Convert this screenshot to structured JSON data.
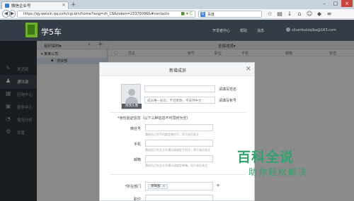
{
  "browser": {
    "tab_title": "微信企业号",
    "new_tab": "+",
    "url": "https://qy.weixin.qq.com/cgi-bin/home?lang=zh_CN&token=23370096&#contacts",
    "search_placeholder": "百度",
    "search_engine_badge": "G"
  },
  "header": {
    "app_name": "学5车",
    "links": [
      "开发者中心",
      "帮助",
      "消息"
    ],
    "user_email": "silverbulsiqiba@163.com"
  },
  "sidebar": {
    "items": [
      {
        "label": "发消息",
        "icon": "pencil-icon"
      },
      {
        "label": "通讯录",
        "icon": "contacts-icon"
      },
      {
        "label": "应用中心",
        "icon": "apps-icon"
      },
      {
        "label": "服务中心",
        "icon": "service-icon"
      },
      {
        "label": "使用分析",
        "icon": "analytics-icon"
      },
      {
        "label": "设置",
        "icon": "gear-icon"
      }
    ]
  },
  "tree": {
    "title": "组织架构▾",
    "company": "▾ 某某公司",
    "dept": "项目部"
  },
  "main": {
    "title": "全部成员▾",
    "columns": [
      "姓名",
      "帐号",
      "职位",
      "手机",
      "邮箱",
      "状态"
    ]
  },
  "modal": {
    "title": "新增成员",
    "close": "×",
    "avatar_button": "修改头像",
    "name_placeholder": "",
    "name_hint": "请填写姓名",
    "account_placeholder": "成员唯一标识，不可更改，不支持中文",
    "account_hint": "请填写帐号",
    "id_section": "*身份验证信息（以下三种信息不可同时为空）",
    "wechat_label": "微信号",
    "wechat_hint": "需成员已在手机绑定微信号，用于成员关注",
    "phone_label": "手机",
    "phone_hint": "需成员已在企业号通讯录绑定手机号，用于成员关注",
    "email_label": "邮箱",
    "email_hint": "需成员已在企业号通讯录绑定邮箱，用于成员关注",
    "dept_label": "*所在部门",
    "dept_tag": "项目部",
    "dept_add": "+",
    "title_label": "职位"
  },
  "watermark": {
    "title": "百科全说",
    "subtitle": "助你轻松解决"
  }
}
